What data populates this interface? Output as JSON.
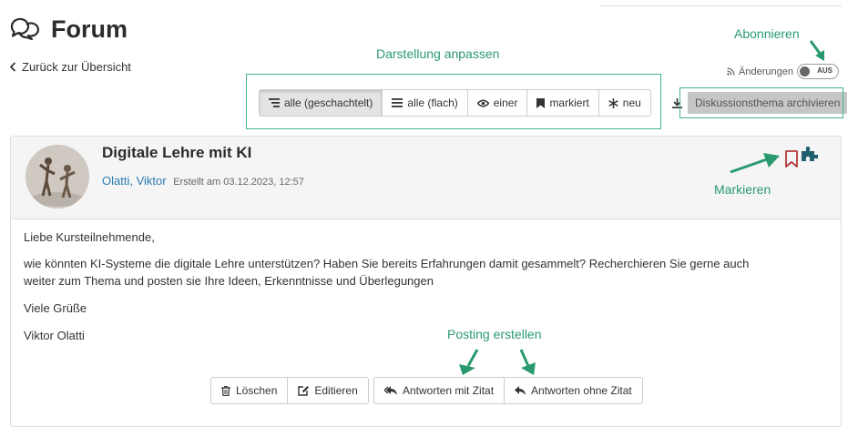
{
  "header": {
    "title": "Forum",
    "back_label": "Zurück zur Übersicht"
  },
  "subscription": {
    "label": "Änderungen",
    "toggle_state": "AUS"
  },
  "view_buttons": [
    {
      "label": "alle (geschachtelt)",
      "icon": "nested-list-icon",
      "active": true
    },
    {
      "label": "alle (flach)",
      "icon": "flat-list-icon",
      "active": false
    },
    {
      "label": "einer",
      "icon": "eye-icon",
      "active": false
    },
    {
      "label": "markiert",
      "icon": "bookmark-icon",
      "active": false
    },
    {
      "label": "neu",
      "icon": "asterisk-icon",
      "active": false
    }
  ],
  "archive_label": "Diskussionsthema archivieren",
  "post": {
    "title": "Digitale Lehre mit KI",
    "author": "Olatti, Viktor",
    "date": "Erstellt am 03.12.2023, 12:57",
    "greeting": "Liebe Kursteilnehmende,",
    "paragraph_line1": "wie könnten KI-Systeme die digitale Lehre unterstützen? Haben Sie bereits Erfahrungen damit gesammelt? Recherchieren Sie gerne auch",
    "paragraph_line2": "weiter zum Thema und posten sie Ihre Ideen, Erkenntnisse und Überlegungen",
    "closing": "Viele Grüße",
    "signature": "Viktor Olatti"
  },
  "post_actions": {
    "delete": "Löschen",
    "edit": "Editieren",
    "reply_quote": "Antworten mit Zitat",
    "reply_noquote": "Antworten ohne Zitat"
  },
  "annotations": {
    "display": "Darstellung anpassen",
    "subscribe": "Abonnieren",
    "mark": "Markieren",
    "posting": "Posting erstellen"
  },
  "colors": {
    "annotation": "#2a9a6e",
    "link": "#2a7ab0",
    "bookmark": "#b03a3a",
    "puzzle": "#1f5f6e"
  }
}
